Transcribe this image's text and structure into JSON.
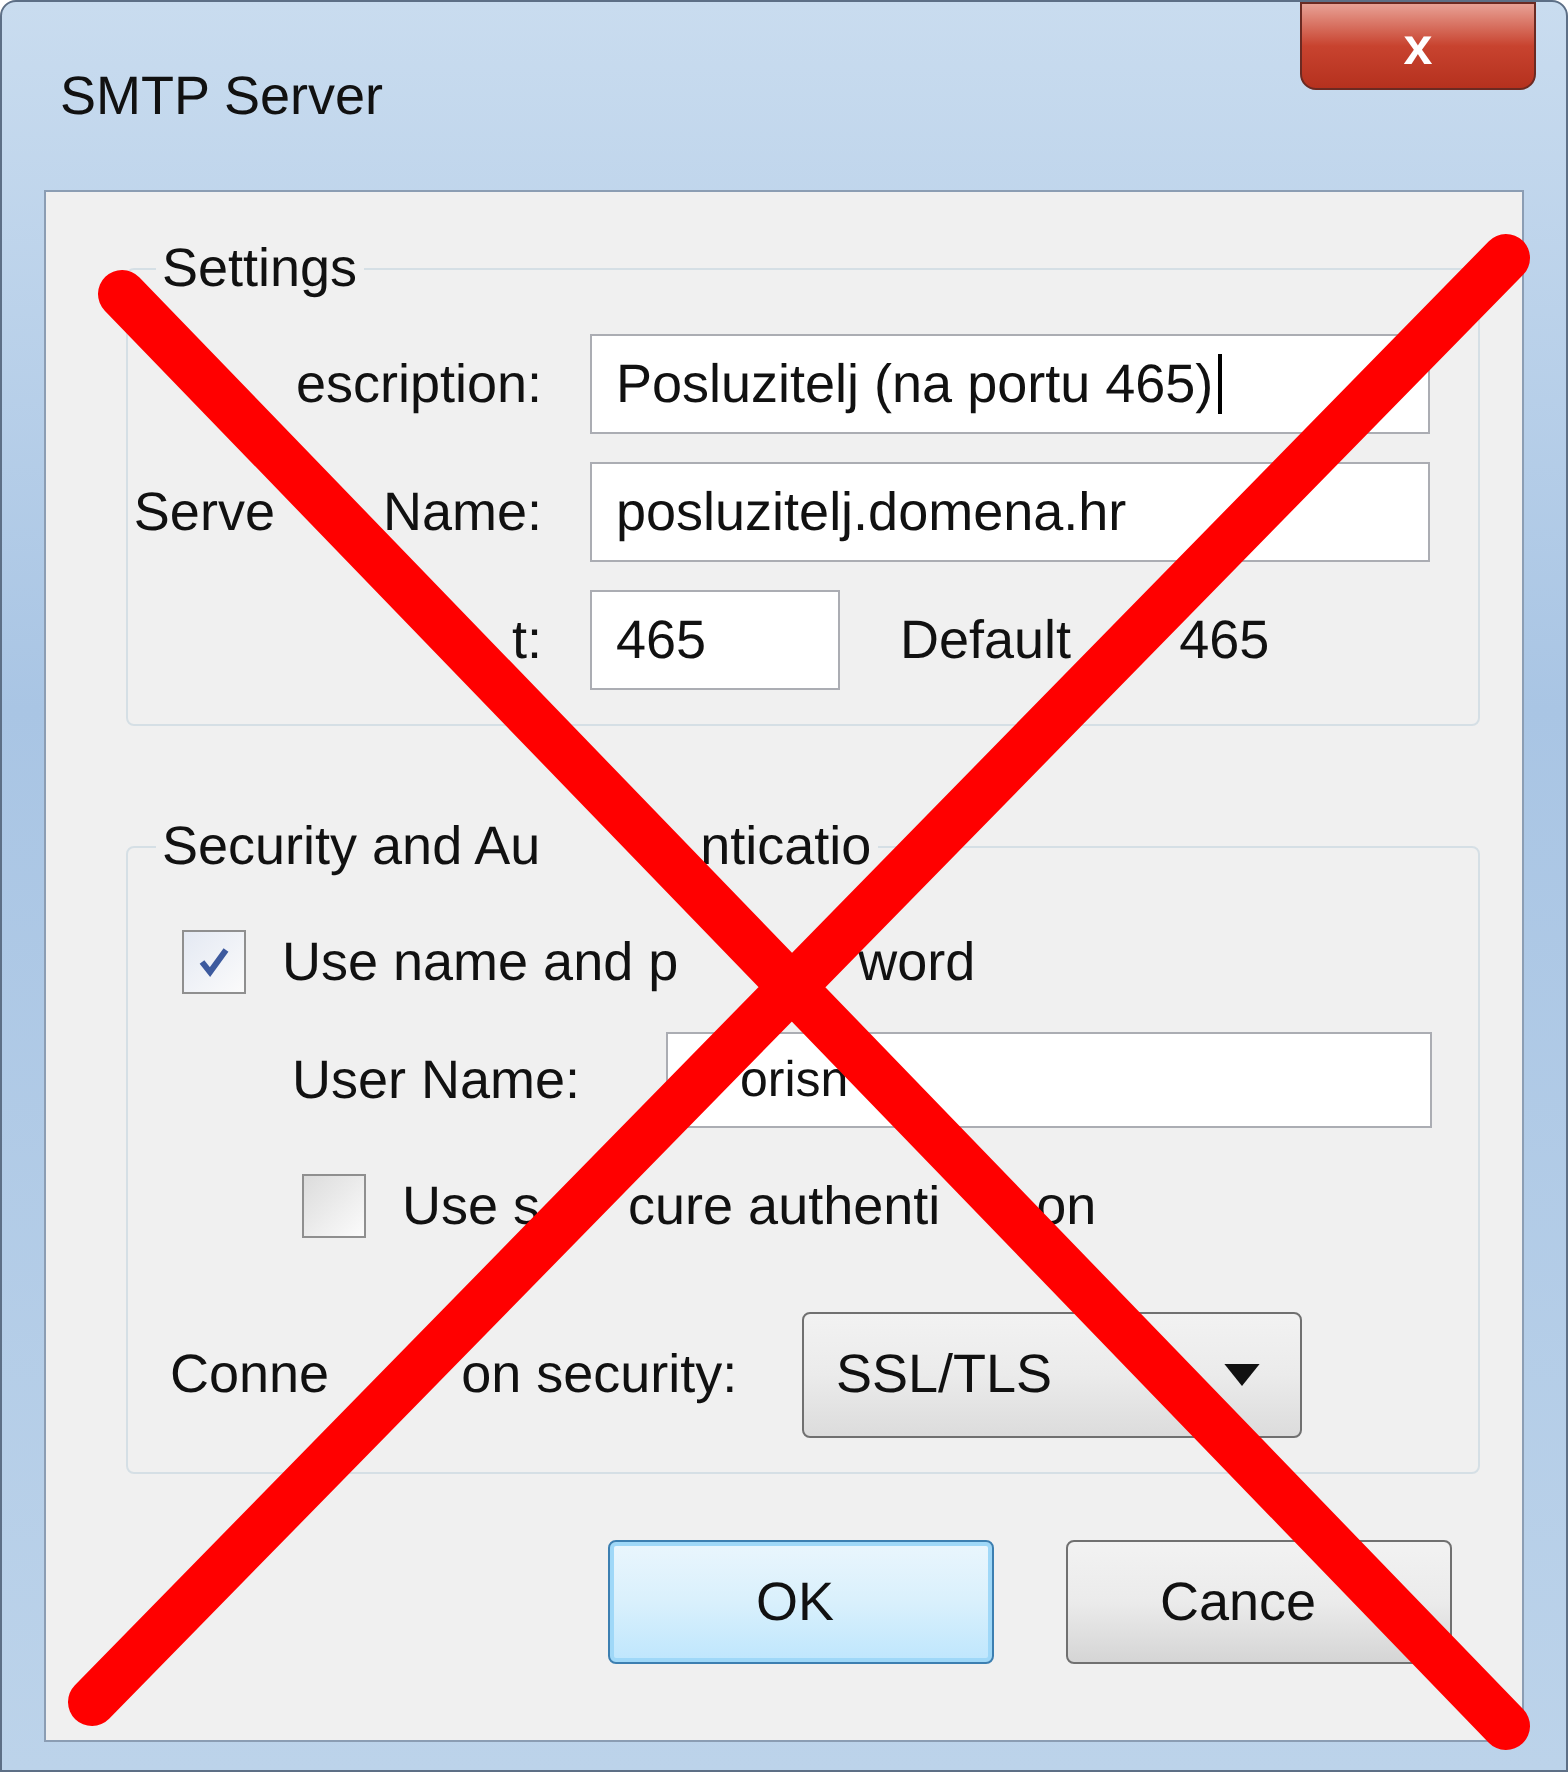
{
  "window": {
    "title": "SMTP Server",
    "close": "x"
  },
  "settings": {
    "legend": "Settings",
    "fields": [
      {
        "label": [
          "escription:"
        ],
        "value": "Posluzitelj (na portu 465)",
        "kind": "wide"
      },
      {
        "label": [
          "Serve",
          "Name:"
        ],
        "value": "posluzitelj.domena.hr",
        "kind": "wide"
      },
      {
        "label": [
          "t:"
        ],
        "value": "465",
        "kind": "short",
        "note": [
          "Default",
          "465"
        ]
      }
    ]
  },
  "security": {
    "legend": [
      "Security and Au",
      "nticatio"
    ],
    "use_name": {
      "label": [
        "Use name and p",
        "word"
      ],
      "checked": true
    },
    "user_name": {
      "label": "User Name:",
      "value": "orisn"
    },
    "secure_auth": {
      "label": [
        "Use s",
        "cure authenti",
        "on"
      ],
      "checked": false
    },
    "connection": {
      "label": [
        "Conne",
        "on security:"
      ],
      "value": "SSL/TLS"
    }
  },
  "buttons": [
    {
      "label": "OK",
      "default": true
    },
    {
      "label": "Cance",
      "default": false
    }
  ],
  "overlay": {
    "kind": "cross"
  }
}
